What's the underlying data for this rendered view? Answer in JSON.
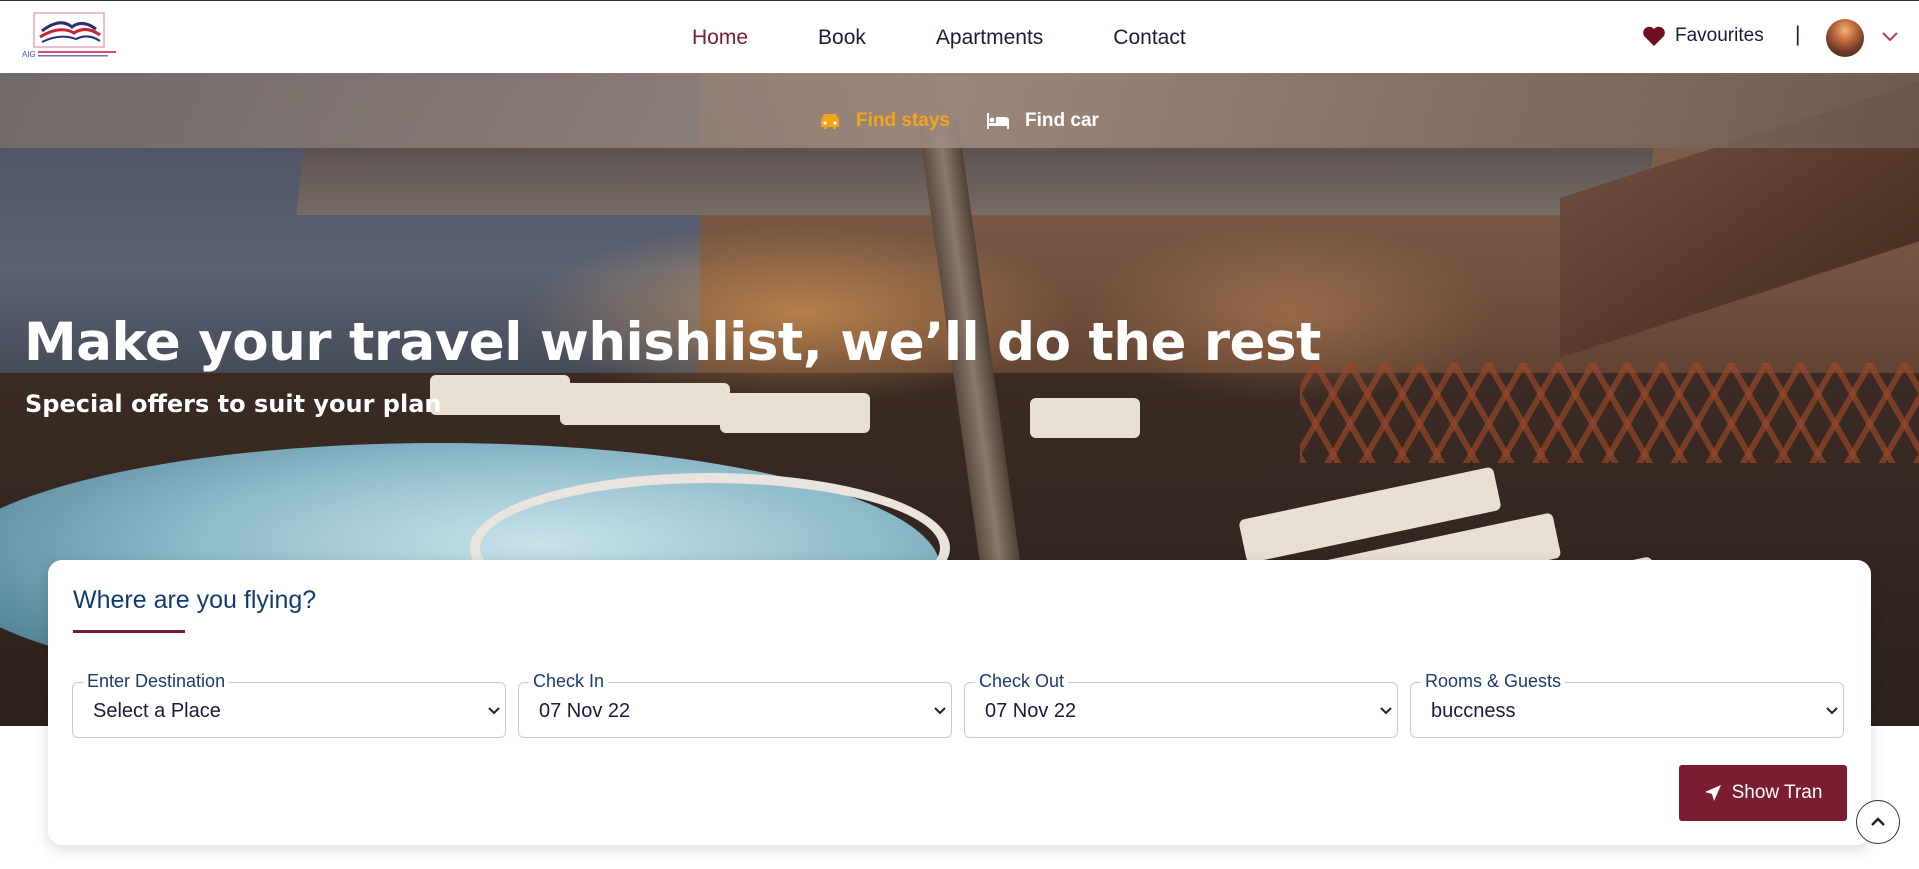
{
  "header": {
    "nav": [
      "Home",
      "Book",
      "Apartments",
      "Contact"
    ],
    "active_nav": "Home",
    "favourites_label": "Favourites",
    "separator": "|",
    "logo_text": "AIG"
  },
  "hero": {
    "tabs": {
      "stays_label": "Find stays",
      "car_label": "Find car"
    },
    "headline": "Make your travel whishlist, we’ll do the rest",
    "subheadline": "Special offers to suit your plan"
  },
  "search": {
    "title": "Where are you flying?",
    "fields": [
      {
        "label": "Enter Destination",
        "value": "Select a Place"
      },
      {
        "label": "Check In",
        "value": "07 Nov 22"
      },
      {
        "label": "Check Out",
        "value": "07 Nov 22"
      },
      {
        "label": "Rooms & Guests",
        "value": "buccness"
      }
    ],
    "submit_label": "Show Tran"
  },
  "colors": {
    "brand": "#7b1c30",
    "accent_tab": "#f3a51a",
    "title_blue": "#133b70"
  },
  "icons": [
    "heart-icon",
    "chevron-down-icon",
    "car-icon",
    "bed-icon",
    "send-icon",
    "chevron-up-icon"
  ]
}
